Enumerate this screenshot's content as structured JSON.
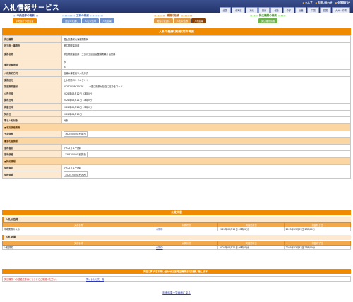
{
  "header": {
    "title": "入札情報サービス",
    "links": [
      "ヘルプ",
      "お問い合わせ",
      "全国版TOP"
    ],
    "regions": [
      "全国",
      "北海道",
      "東北",
      "関東",
      "北陸",
      "中部",
      "近畿",
      "中国",
      "四国",
      "九州・沖縄"
    ]
  },
  "nav": {
    "groups": [
      {
        "title": "中央省庁の検索",
        "color": "#2a3b8a",
        "tabs": [
          {
            "label": "中央省庁の発注者",
            "color": "#f08a00"
          }
        ]
      },
      {
        "title": "工事の検索",
        "color": "#3f69b8",
        "tabs": [
          {
            "label": "発注の見通し",
            "color": "#6f93cf"
          },
          {
            "label": "入札公告等",
            "color": "#6f93cf"
          },
          {
            "label": "入札結果",
            "color": "#6f93cf"
          }
        ]
      },
      {
        "title": "業務の検索",
        "color": "#b55600",
        "tabs": [
          {
            "label": "発注の見通し",
            "color": "#e69c43"
          },
          {
            "label": "入札公告等",
            "color": "#e69c43"
          },
          {
            "label": "入札結果",
            "color": "#8a3f00"
          }
        ]
      },
      {
        "title": "発注機関の検索",
        "color": "#3e8a26",
        "tabs": [
          {
            "label": "発注機関情報",
            "color": "#6bb54a"
          }
        ]
      }
    ]
  },
  "detail": {
    "section_title": "入札の経緯(業務)案件概要",
    "rows": [
      {
        "label": "発注機関",
        "value": "国土交通省北海道開発局"
      },
      {
        "label": "担当部・事務所",
        "value": "帯広開発建設部"
      },
      {
        "label": "業務名称",
        "value": "帯広開発建設部　三日月工区区画整備測量計画業務"
      },
      {
        "label": "業務対象地域",
        "value": "市:",
        "value2": "区:"
      },
      {
        "label": "入札契約方式",
        "value": "簡易公募型競争入札方式"
      },
      {
        "label": "業務区分",
        "value": "土木関係コンサルタント"
      },
      {
        "label": "調達案件番号",
        "value": "2024215862002E",
        "note": "※発注機関が独自に定めるコード"
      },
      {
        "label": "公告日時",
        "value": "2024年03月12日 07時00分"
      },
      {
        "label": "開札日時",
        "value": "2024年05月21日 11時00分"
      },
      {
        "label": "掲載日時",
        "value": "2024年05月28日 13時00分"
      },
      {
        "label": "契約日",
        "value": "2024年04月10日"
      },
      {
        "label": "電子入札対象",
        "value": "対象"
      }
    ],
    "price_group": "■予定価格情報",
    "price_rows": [
      {
        "label": "予定価格",
        "value": "16,250,000(税抜き)"
      }
    ],
    "winner_group": "■落札者情報",
    "winner_rows": [
      {
        "label": "落札者名",
        "value": "アルスマエヤ(株)"
      },
      {
        "label": "落札価格",
        "value": "13,870,000(税抜き)"
      }
    ],
    "contract_group": "■契約情報",
    "contract_rows": [
      {
        "label": "契約者名",
        "value": "アルスマエヤ(株)"
      },
      {
        "label": "契約金額",
        "value": "15,257,000(税込み)"
      }
    ]
  },
  "attachments": {
    "title": "公開文書",
    "columns": [
      "文書名称",
      "公開状況",
      "掲載更新日",
      "掲載終了日"
    ],
    "koukoku": {
      "title": "入札公告等",
      "rows": [
        {
          "name": "半成業務の公示",
          "status": "公開中",
          "start": "2024年03月12日 09時00分",
          "end": "2025年03月31日 23時00分"
        }
      ]
    },
    "kekka": {
      "title": "入札結果",
      "rows": [
        {
          "name": "入札調書",
          "status": "公開中",
          "start": "2024年06月22日 09時05分",
          "end": "2025年03月31日 23時00分"
        }
      ]
    }
  },
  "footer": {
    "contact_title": "内容に関するお問い合わせは各発注機関までお願い致します。",
    "contact_label": "発注機関への連絡先等はこちらからご確認ください。",
    "contact_link": "問い合わせ先一覧",
    "back_link": "検索結果一覧画面に戻る"
  }
}
